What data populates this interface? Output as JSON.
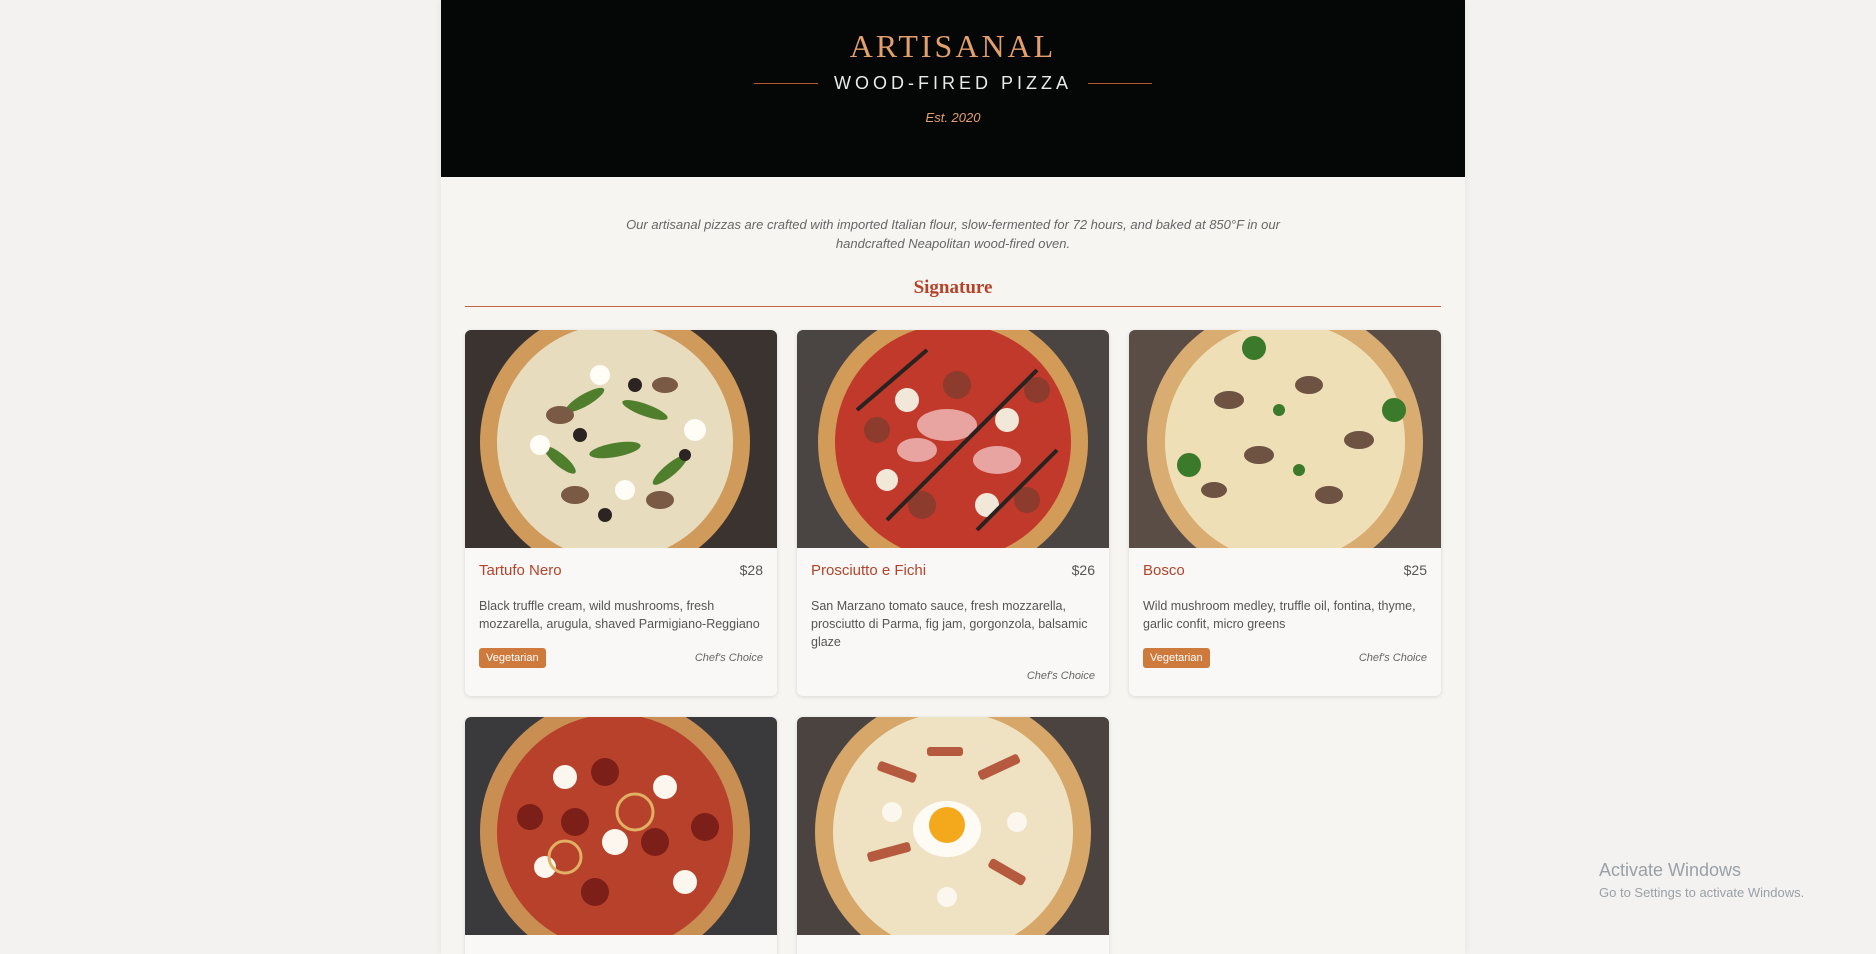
{
  "header": {
    "brand": "ARTISANAL",
    "subtitle": "WOOD-FIRED PIZZA",
    "established": "Est. 2020"
  },
  "intro": "Our artisanal pizzas are crafted with imported Italian flour, slow-fermented for 72 hours, and baked at 850°F in our handcrafted Neapolitan wood-fired oven.",
  "section": {
    "title": "Signature"
  },
  "pizzas": [
    {
      "name": "Tartufo Nero",
      "price": "$28",
      "description": "Black truffle cream, wild mushrooms, fresh mozzarella, arugula, shaved Parmigiano-Reggiano",
      "badge": "Vegetarian",
      "tag": "Chef's Choice",
      "image": "truffle-mushroom-arugula-pizza"
    },
    {
      "name": "Prosciutto e Fichi",
      "price": "$26",
      "description": "San Marzano tomato sauce, fresh mozzarella, prosciutto di Parma, fig jam, gorgonzola, balsamic glaze",
      "badge": "",
      "tag": "Chef's Choice",
      "image": "prosciutto-fig-pizza"
    },
    {
      "name": "Bosco",
      "price": "$25",
      "description": "Wild mushroom medley, truffle oil, fontina, thyme, garlic confit, micro greens",
      "badge": "Vegetarian",
      "tag": "Chef's Choice",
      "image": "mushroom-herb-pizza"
    },
    {
      "name": "",
      "price": "",
      "description": "",
      "badge": "",
      "tag": "",
      "image": "spicy-salami-pizza"
    },
    {
      "name": "",
      "price": "",
      "description": "",
      "badge": "",
      "tag": "",
      "image": "bacon-egg-pizza"
    }
  ],
  "watermark": {
    "line1": "Activate Windows",
    "line2": "Go to Settings to activate Windows."
  },
  "colors": {
    "header_bg": "#050606",
    "accent": "#e3a06c",
    "title_red": "#b5432a",
    "badge": "#cf7a3d"
  }
}
